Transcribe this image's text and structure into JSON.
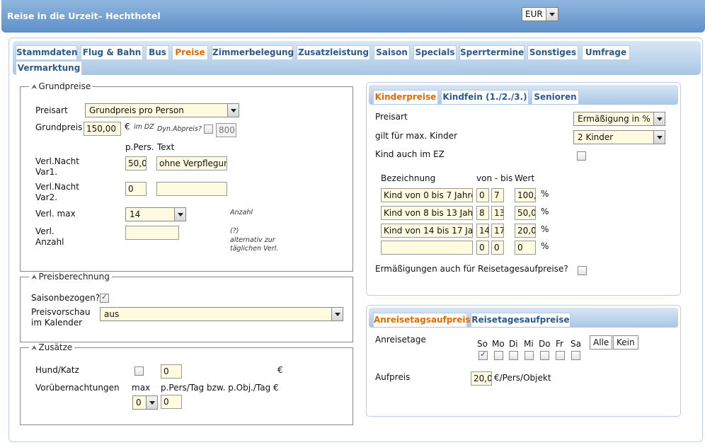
{
  "header": {
    "title": "Reise in die Urzeit– Hechthotel",
    "currency": "EUR"
  },
  "tabs": [
    {
      "label": "Stammdaten"
    },
    {
      "label": "Flug & Bahn"
    },
    {
      "label": "Bus"
    },
    {
      "label": "Preise",
      "active": true
    },
    {
      "label": "Zimmerbelegung"
    },
    {
      "label": "Zusatzleistung"
    },
    {
      "label": "Saison"
    },
    {
      "label": "Specials"
    },
    {
      "label": "Sperrtermine"
    },
    {
      "label": "Sonstiges"
    },
    {
      "label": "Umfrage"
    },
    {
      "label": "Vermarktung"
    }
  ],
  "grundpreise": {
    "legend": "Grundpreise",
    "preisart_label": "Preisart",
    "preisart_value": "Grundpreis pro Person",
    "grundpreis_label": "Grundpreis",
    "grundpreis_value": "150,00",
    "euro": "€",
    "im_dz": "im DZ",
    "dyn_label": "Dyn.Abpreis?",
    "dyn_value": "800,",
    "col_ppers": "p.Pers.",
    "col_text": "Text",
    "var1_label": "Verl.Nacht Var1.",
    "var1_value": "50,0",
    "var1_text": "ohne Verpflegun",
    "var2_label": "Verl.Nacht Var2.",
    "var2_value": "0",
    "var2_text": "",
    "max_label": "Verl. max",
    "max_value": "14",
    "anzahl_hint": "Anzahl",
    "anzahl_label": "Verl. Anzahl",
    "anzahl_value": "",
    "note_q": "(?)",
    "note_text": "alternativ zur täglichen Verl."
  },
  "preisberechnung": {
    "legend": "Preisberechnung",
    "saison_label": "Saisonbezogen?",
    "saison_checked": true,
    "vorschau_label": "Preisvorschau im Kalender",
    "vorschau_value": "aus"
  },
  "zusaetze": {
    "legend": "Zusätze",
    "hund_label": "Hund/Katz",
    "hund_checked": false,
    "hund_value": "0",
    "euro": "€",
    "vor_label": "Vorübernachtungen",
    "max_label": "max",
    "max_value": "0",
    "ppers_label": "p.Pers/Tag bzw. p.Obj./Tag €",
    "ppers_value": "0"
  },
  "kinder": {
    "tabs": [
      {
        "label": "Kinderpreise",
        "active": true
      },
      {
        "label": "Kindfein (1./2./3.)"
      },
      {
        "label": "Senioren"
      }
    ],
    "preisart_label": "Preisart",
    "preisart_value": "Ermäßigung in %",
    "max_kinder_label": "gilt für max. Kinder",
    "max_kinder_value": "2 Kinder",
    "ez_label": "Kind auch im EZ",
    "col_bez": "Bezeichnung",
    "col_vonbis": "von - bis",
    "col_wert": "Wert",
    "rows": [
      {
        "bez": "Kind von 0 bis 7 Jahre",
        "von": "0",
        "bis": "7",
        "wert": "100,",
        "unit": "%"
      },
      {
        "bez": "Kind von 8 bis 13 Jah",
        "von": "8",
        "bis": "13",
        "wert": "50,0",
        "unit": "%"
      },
      {
        "bez": "Kind von 14 bis 17 Ja",
        "von": "14",
        "bis": "17",
        "wert": "20,0",
        "unit": "%"
      },
      {
        "bez": "",
        "von": "0",
        "bis": "0",
        "wert": "0",
        "unit": "%"
      }
    ],
    "erm_label": "Ermäßigungen auch für Reisetagesaufpreise?"
  },
  "anreise": {
    "tabs": [
      {
        "label": "Anreisetagsaufpreis",
        "active": true
      },
      {
        "label": "Reisetagesaufpreise"
      }
    ],
    "tage_label": "Anreisetage",
    "days": [
      {
        "label": "So",
        "checked": true
      },
      {
        "label": "Mo",
        "checked": false
      },
      {
        "label": "Di",
        "checked": false
      },
      {
        "label": "Mi",
        "checked": false
      },
      {
        "label": "Do",
        "checked": false
      },
      {
        "label": "Fr",
        "checked": false
      },
      {
        "label": "Sa",
        "checked": false
      }
    ],
    "alle": "Alle",
    "kein": "Kein",
    "aufpreis_label": "Aufpreis",
    "aufpreis_value": "20,0",
    "aufpreis_unit": "€/Pers/Objekt"
  }
}
